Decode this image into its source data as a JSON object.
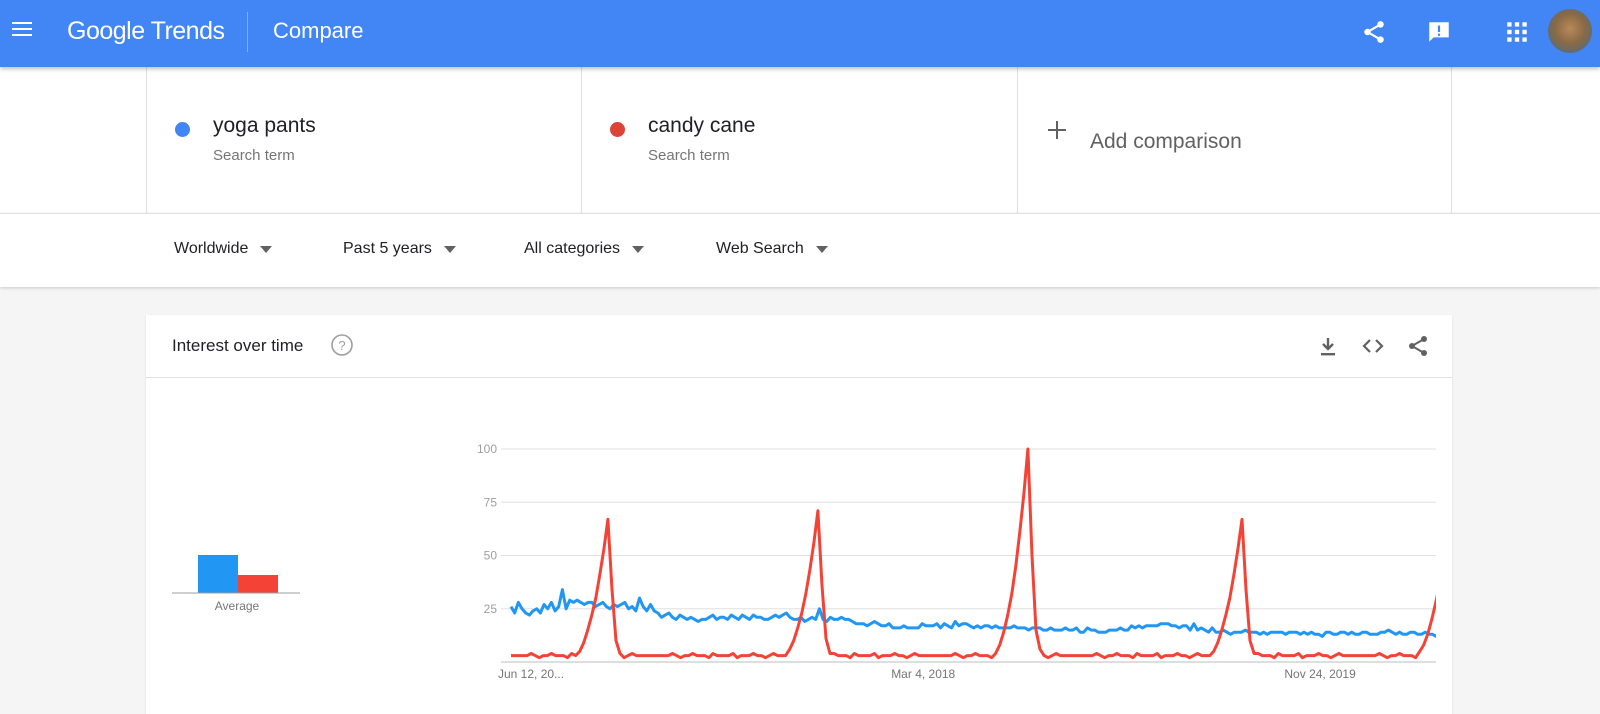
{
  "header": {
    "brand": "Google Trends",
    "page_title": "Compare",
    "icons": [
      "menu-icon",
      "share-icon",
      "feedback-icon",
      "apps-icon",
      "avatar"
    ],
    "background": "#4285f4"
  },
  "terms": [
    {
      "name": "yoga pants",
      "type": "Search term",
      "color": "#4285f4"
    },
    {
      "name": "candy cane",
      "type": "Search term",
      "color": "#db4437"
    }
  ],
  "add_comparison": {
    "label": "Add comparison"
  },
  "filters": [
    {
      "label": "Worldwide"
    },
    {
      "label": "Past 5 years"
    },
    {
      "label": "All categories"
    },
    {
      "label": "Web Search"
    }
  ],
  "card": {
    "title": "Interest over time",
    "icons": [
      "help-icon",
      "download-icon",
      "embed-icon",
      "share-icon"
    ]
  },
  "chart_data": [
    {
      "type": "bar",
      "categories": [
        "Average"
      ],
      "series": [
        {
          "name": "yoga pants",
          "values": [
            19
          ],
          "color": "#2196f3"
        },
        {
          "name": "candy cane",
          "values": [
            9
          ],
          "color": "#f44336"
        }
      ],
      "ylim": [
        0,
        100
      ]
    },
    {
      "type": "line",
      "xlabel": "",
      "ylabel": "",
      "yticks": [
        25,
        50,
        75,
        100
      ],
      "ylim": [
        0,
        100
      ],
      "x_tick_labels": [
        {
          "label": "Jun 12, 20...",
          "index": 0
        },
        {
          "label": "Mar 4, 2018",
          "index": 90
        },
        {
          "label": "Nov 24, 2019",
          "index": 180
        }
      ],
      "grid": true,
      "series": [
        {
          "name": "yoga pants",
          "color": "#2196f3",
          "values": [
            26,
            23,
            28,
            25,
            23,
            22,
            24,
            25,
            23,
            27,
            25,
            28,
            24,
            26,
            34,
            25,
            29,
            28,
            29,
            28,
            27,
            28,
            28,
            26,
            27,
            28,
            26,
            25,
            27,
            26,
            27,
            28,
            25,
            26,
            24,
            30,
            26,
            24,
            27,
            24,
            23,
            21,
            22,
            23,
            21,
            20,
            22,
            21,
            20,
            21,
            20,
            19,
            20,
            20,
            21,
            22,
            20,
            21,
            21,
            20,
            22,
            21,
            20,
            22,
            21,
            20,
            22,
            21,
            21,
            20,
            20,
            21,
            22,
            21,
            22,
            23,
            21,
            20,
            20,
            21,
            19,
            20,
            21,
            20,
            25,
            20,
            19,
            21,
            20,
            20,
            21,
            20,
            20,
            19,
            18,
            18,
            18,
            17,
            18,
            19,
            18,
            17,
            17,
            18,
            16,
            16,
            16,
            17,
            16,
            16,
            16,
            16,
            18,
            17,
            17,
            17,
            18,
            16,
            18,
            17,
            16,
            19,
            17,
            18,
            18,
            17,
            16,
            17,
            16,
            17,
            17,
            16,
            17,
            16,
            16,
            16,
            16,
            17,
            16,
            16,
            16,
            15,
            16,
            16,
            16,
            15,
            15,
            16,
            15,
            15,
            15,
            16,
            15,
            15,
            16,
            14,
            14,
            16,
            15,
            15,
            14,
            14,
            14,
            15,
            15,
            15,
            16,
            15,
            15,
            17,
            16,
            17,
            16,
            17,
            17,
            17,
            17,
            18,
            18,
            18,
            17,
            17,
            16,
            17,
            17,
            15,
            18,
            15,
            16,
            15,
            14,
            16,
            14,
            14,
            15,
            14,
            13,
            14,
            14,
            14,
            15,
            14,
            14,
            14,
            13,
            14,
            13,
            14,
            14,
            14,
            14,
            13,
            14,
            14,
            14,
            13,
            14,
            13,
            14,
            13,
            13,
            12,
            14,
            14,
            13,
            13,
            14,
            14,
            13,
            14,
            13,
            13,
            14,
            14,
            13,
            13,
            13,
            14,
            14,
            15,
            14,
            13,
            14,
            13,
            13,
            14,
            14,
            13,
            13,
            14,
            13,
            13,
            12,
            12,
            13,
            12,
            13,
            13,
            13,
            12,
            13,
            13,
            13,
            13,
            12,
            12,
            13,
            13,
            13,
            12,
            13,
            12,
            13,
            12,
            13,
            13,
            12,
            12,
            13,
            12,
            12,
            13,
            12,
            12,
            12,
            12,
            11
          ],
          "values_note_ignore": null
        },
        {
          "name": "candy cane",
          "color": "#f44336",
          "values": []
        }
      ]
    }
  ]
}
